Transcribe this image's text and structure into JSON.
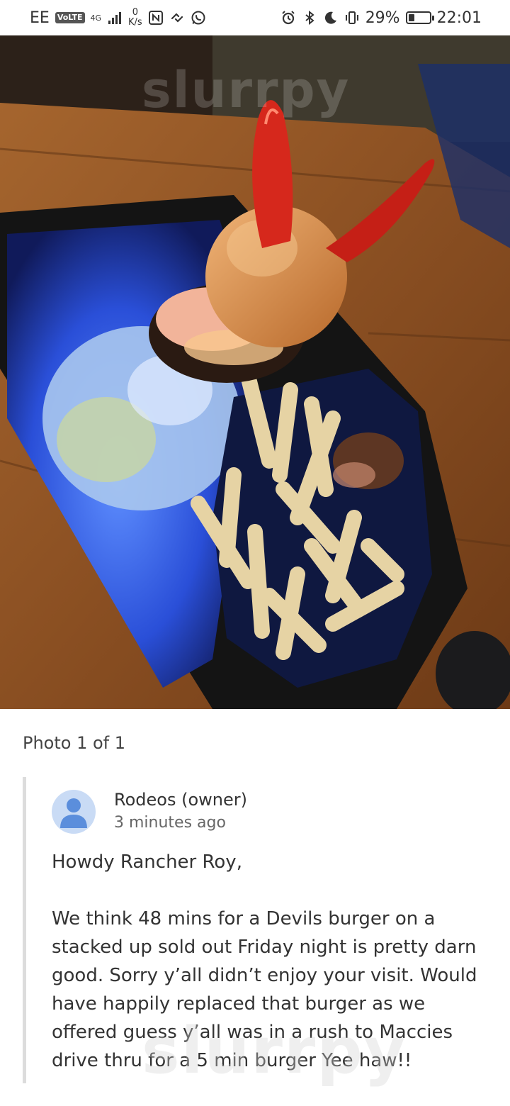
{
  "status_bar": {
    "carrier": "EE",
    "volte": "VoLTE",
    "network": "4G",
    "speed_value": "0",
    "speed_unit": "K/s",
    "battery_percent": "29%",
    "time": "22:01",
    "battery_level": 0.29
  },
  "photo": {
    "watermark": "slurrpy"
  },
  "caption": "Photo 1 of 1",
  "reply": {
    "author": "Rodeos (owner)",
    "time_ago": "3 minutes ago",
    "greeting": "Howdy Rancher Roy,",
    "body": "We think 48 mins for a Devils burger on a stacked up sold out Friday night is pretty darn good. Sorry y’all didn’t enjoy your visit. Would have happily replaced that burger as we offered guess y’all was in a rush to Maccies drive thru for a 5 min burger Yee haw!!"
  },
  "watermark": "slurrpy"
}
